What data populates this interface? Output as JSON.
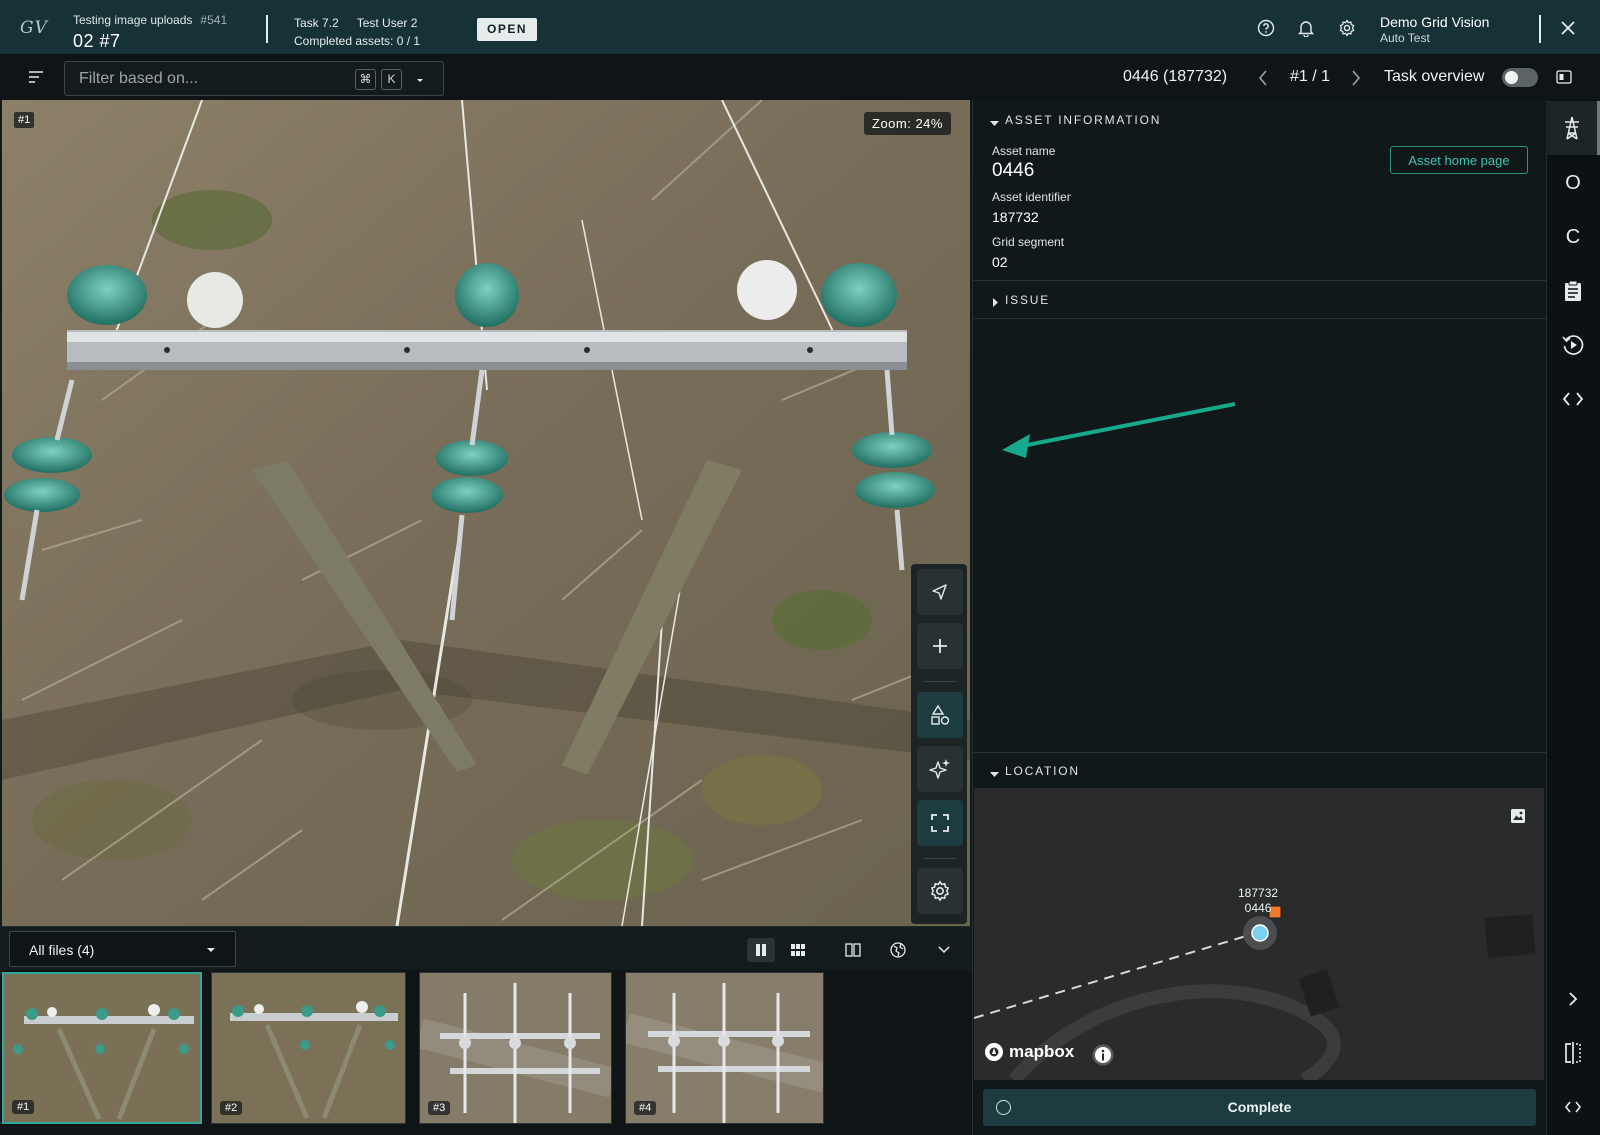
{
  "header": {
    "logo": "GV",
    "project_name": "Testing image uploads",
    "project_number": "#541",
    "project_sub": "02 #7",
    "task_line1_a": "Task 7.2",
    "task_line1_b": "Test User 2",
    "task_line2": "Completed assets: 0 / 1",
    "status": "OPEN",
    "org_name": "Demo Grid Vision",
    "org_role": "Auto Test",
    "icons": [
      "help-icon",
      "bell-icon",
      "gear-icon",
      "close-icon"
    ]
  },
  "filter": {
    "placeholder": "Filter based on...",
    "shortcut_cmd": "⌘",
    "shortcut_key": "K",
    "asset_nav": "0446 (187732)",
    "position": "#1 / 1",
    "task_overview_label": "Task overview",
    "task_overview_on": false
  },
  "viewer": {
    "image_tag": "#1",
    "zoom": "Zoom: 24%",
    "tools": [
      "select-arrow-icon",
      "plus-icon",
      "shapes-icon",
      "ai-sparkle-icon",
      "fullscreen-icon",
      "gear-icon"
    ]
  },
  "files": {
    "selector": "All files (4)",
    "thumbnails": [
      {
        "label": "#1",
        "selected": true
      },
      {
        "label": "#2",
        "selected": false
      },
      {
        "label": "#3",
        "selected": false
      },
      {
        "label": "#4",
        "selected": false
      }
    ]
  },
  "panel": {
    "asset_info_title": "ASSET INFORMATION",
    "asset_name_label": "Asset name",
    "asset_name": "0446",
    "asset_home_button": "Asset home page",
    "asset_id_label": "Asset identifier",
    "asset_id": "187732",
    "grid_segment_label": "Grid segment",
    "grid_segment": "02",
    "issue_title": "ISSUE",
    "location_title": "LOCATION",
    "map_marker_id": "187732",
    "map_marker_name": "0446",
    "map_attribution": "mapbox",
    "complete_button": "Complete"
  },
  "rail": {
    "items": [
      "pylon-icon",
      "O",
      "C",
      "clipboard-icon",
      "history-icon",
      "code-icon"
    ],
    "bottom": [
      "chevron-right-icon",
      "split-view-icon",
      "code-icon"
    ]
  },
  "colors": {
    "accent": "#2fa899",
    "header_bg": "#173236",
    "panel_bg": "#101819",
    "marker": "#7ad2f0",
    "marker_square": "#f07a2a",
    "arrow": "#18a98d"
  }
}
